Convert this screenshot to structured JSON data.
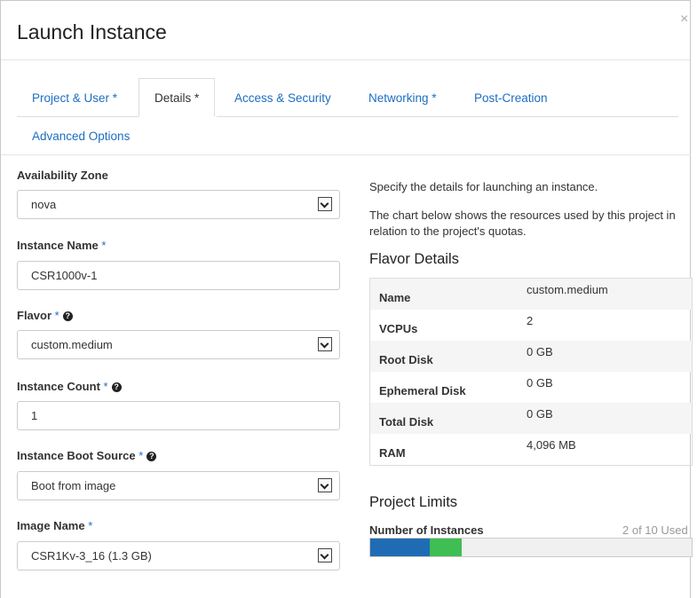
{
  "modal": {
    "title": "Launch Instance",
    "close_label": "×"
  },
  "tabs": [
    {
      "label": "Project & User *",
      "active": false
    },
    {
      "label": "Details *",
      "active": true
    },
    {
      "label": "Access & Security",
      "active": false
    },
    {
      "label": "Networking *",
      "active": false
    },
    {
      "label": "Post-Creation",
      "active": false
    },
    {
      "label": "Advanced Options",
      "active": false
    }
  ],
  "form": {
    "availability_zone": {
      "label": "Availability Zone",
      "value": "nova"
    },
    "instance_name": {
      "label": "Instance Name",
      "required": "*",
      "value": "CSR1000v-1"
    },
    "flavor": {
      "label": "Flavor",
      "required": "*",
      "value": "custom.medium"
    },
    "instance_count": {
      "label": "Instance Count",
      "required": "*",
      "value": "1"
    },
    "boot_source": {
      "label": "Instance Boot Source",
      "required": "*",
      "value": "Boot from image"
    },
    "image_name": {
      "label": "Image Name",
      "required": "*",
      "value": "CSR1Kv-3_16 (1.3 GB)"
    }
  },
  "info": {
    "line1": "Specify the details for launching an instance.",
    "line2": "The chart below shows the resources used by this project in relation to the project's quotas."
  },
  "flavor_details": {
    "title": "Flavor Details",
    "rows": [
      {
        "name": "Name",
        "value": "custom.medium"
      },
      {
        "name": "VCPUs",
        "value": "2"
      },
      {
        "name": "Root Disk",
        "value": "0 GB"
      },
      {
        "name": "Ephemeral Disk",
        "value": "0 GB"
      },
      {
        "name": "Total Disk",
        "value": "0 GB"
      },
      {
        "name": "RAM",
        "value": "4,096 MB"
      }
    ]
  },
  "project_limits": {
    "title": "Project Limits",
    "label": "Number of Instances",
    "used_text": "2 of 10 Used",
    "used": 2,
    "total": 10,
    "new": 1,
    "colors": {
      "used": "#1f6cb5",
      "new": "#3fbe53",
      "free": "#f0f0f0"
    }
  }
}
